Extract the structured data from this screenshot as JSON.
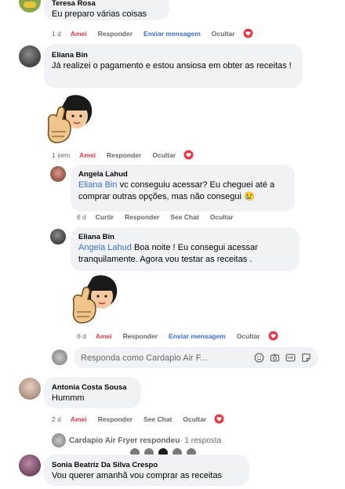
{
  "comments": [
    {
      "id": "teresa",
      "name": "Teresa Rosa",
      "text": "Eu preparo várias coisas",
      "actions": {
        "time": "1 d",
        "amei": "Amei",
        "reply": "Responder",
        "send": "Enviar mensagem",
        "hide": "Ocultar"
      }
    },
    {
      "id": "eliana1",
      "name": "Eliana Bin",
      "text": "Já realizei o pagamento e estou ansiosa em obter as receitas !",
      "actions": {
        "time": "1 sem",
        "amei": "Amei",
        "reply": "Responder",
        "hide": "Ocultar"
      }
    },
    {
      "id": "angela",
      "name": "Angela Lahud",
      "mention": "Eliana Bin",
      "text": " vc conseguiu acessar? Eu cheguei até a comprar outras opções, mas não consegui 😢",
      "actions": {
        "time": "6 d",
        "like": "Curtir",
        "reply": "Responder",
        "see_chat": "See Chat",
        "hide": "Ocultar"
      }
    },
    {
      "id": "eliana2",
      "name": "Eliana Bin",
      "mention": "Angela Lahud",
      "text": " Boa noite ! Eu consegui acessar tranquilamente. Agora vou testar as receitas .",
      "actions": {
        "time": "6 d",
        "amei": "Amei",
        "reply": "Responder",
        "send": "Enviar mensagem",
        "hide": "Ocultar"
      }
    },
    {
      "id": "antonia",
      "name": "Antonia Costa Sousa",
      "text": "Hummm",
      "actions": {
        "time": "2 d",
        "amei": "Amei",
        "reply": "Responder",
        "see_chat": "See Chat",
        "hide": "Ocultar"
      }
    },
    {
      "id": "sonia",
      "name": "Sonia Beatriz Da Silva Crespo",
      "text": "Vou querer amanhã vou comprar as receitas"
    }
  ],
  "reply_box": {
    "placeholder": "Responda como Cardapio Air F..."
  },
  "reply_summary": {
    "author": "Cardapio Air Fryer respondeu",
    "count": " · 1 resposta"
  },
  "carousel": {
    "total": 5,
    "active_index": 2
  },
  "colors": {
    "bubble": "#f0f2f5",
    "amei": "#d93b4a",
    "link": "#3b6fd1",
    "muted": "#65676b"
  },
  "icons": [
    "hide-heart-icon",
    "emoji-icon",
    "camera-icon",
    "gif-icon",
    "sticker-icon",
    "sticker-image"
  ]
}
